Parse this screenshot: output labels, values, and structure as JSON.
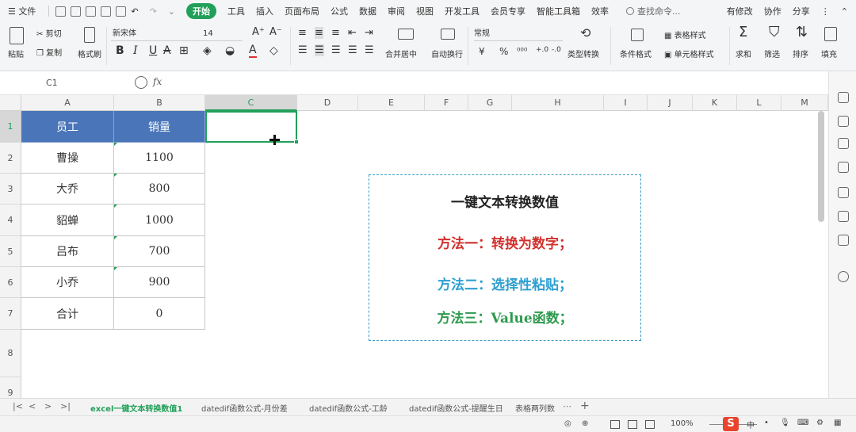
{
  "menubar": {
    "file": "文件",
    "tabs": [
      "开始",
      "工具",
      "插入",
      "页面布局",
      "公式",
      "数据",
      "审阅",
      "视图",
      "开发工具",
      "会员专享",
      "智能工具箱",
      "效率"
    ],
    "search": "查找命令...",
    "right": [
      "有修改",
      "协作",
      "分享"
    ]
  },
  "ribbon": {
    "paste": "粘贴",
    "cut": "剪切",
    "copy": "复制",
    "format_painter": "格式刷",
    "font_name": "新宋体",
    "font_size": "14",
    "number_format": "常规",
    "merge": "合并居中",
    "wrap": "自动换行",
    "type_convert": "类型转换",
    "cond_format": "条件格式",
    "table_style": "表格样式",
    "cell_style": "单元格样式",
    "sum": "求和",
    "filter": "筛选",
    "sort": "排序",
    "fill": "填充",
    "currency": "¥",
    "percent": "%"
  },
  "formula": {
    "namebox": "C1",
    "fx": "fx"
  },
  "columns": [
    "A",
    "B",
    "C",
    "D",
    "E",
    "F",
    "G",
    "H",
    "I",
    "J",
    "K",
    "L",
    "M"
  ],
  "rows": [
    "1",
    "2",
    "3",
    "4",
    "5",
    "6",
    "7",
    "8",
    "9"
  ],
  "table": {
    "header": [
      "员工",
      "销量"
    ],
    "rows": [
      [
        "曹操",
        "1100"
      ],
      [
        "大乔",
        "800"
      ],
      [
        "貂蝉",
        "1000"
      ],
      [
        "吕布",
        "700"
      ],
      [
        "小乔",
        "900"
      ],
      [
        "合计",
        "0"
      ]
    ]
  },
  "textbox": {
    "title": "一键文本转换数值",
    "line1": "方法一：转换为数字；",
    "line2": "方法二：选择性粘贴；",
    "line3": "方法三：Value函数；",
    "colors": {
      "title": "#222222",
      "line1": "#d0312d",
      "line2": "#2e9fd0",
      "line3": "#2e9a4e"
    }
  },
  "sheets": [
    "excel一键文本转换数值1",
    "datedif函数公式-月份差",
    "datedif函数公式-工龄",
    "datedif函数公式-提醒生日",
    "表格两列数"
  ],
  "status": {
    "zoom": "100%",
    "ime": "中"
  },
  "colors": {
    "accent": "#21a05a",
    "header_fill": "#4a76b9"
  }
}
